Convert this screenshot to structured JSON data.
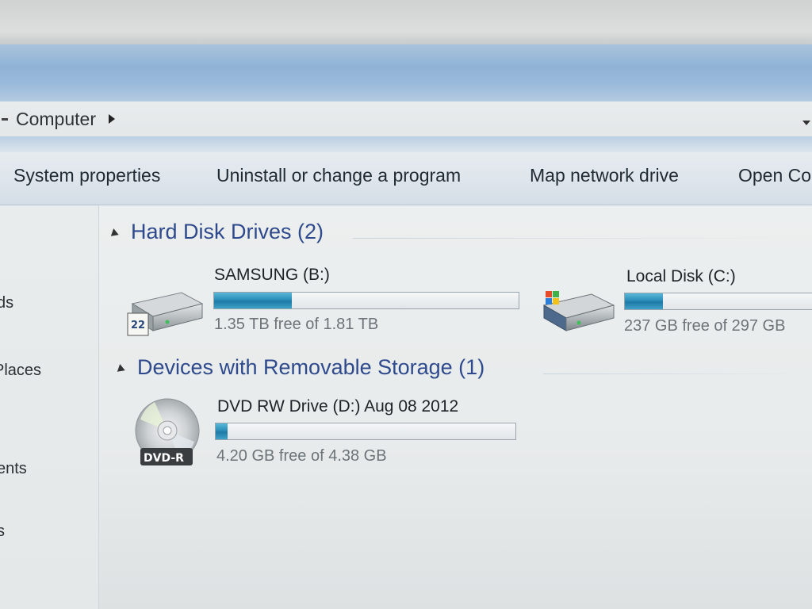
{
  "address": {
    "path": [
      "Computer"
    ]
  },
  "toolbar": {
    "system_properties": "System properties",
    "uninstall": "Uninstall or change a program",
    "map_network": "Map network drive",
    "open_control": "Open Co"
  },
  "nav": {
    "items": [
      {
        "label": "ds"
      },
      {
        "label": "Places"
      },
      {
        "label": "ents"
      },
      {
        "label": "s"
      }
    ]
  },
  "groups": {
    "hard_disks": {
      "title": "Hard Disk Drives (2)",
      "drives": [
        {
          "name": "SAMSUNG (B:)",
          "free_text": "1.35 TB free of 1.81 TB",
          "used_fraction": 0.254,
          "icon": "external-hard-drive-icon",
          "badge": "22"
        },
        {
          "name": "Local Disk (C:)",
          "free_text": "237 GB free of 297 GB",
          "used_fraction": 0.2,
          "icon": "windows-system-drive-icon"
        }
      ]
    },
    "removable": {
      "title": "Devices with Removable Storage (1)",
      "drives": [
        {
          "name": "DVD RW Drive (D:) Aug 08 2012",
          "free_text": "4.20 GB free of 4.38 GB",
          "used_fraction": 0.04,
          "icon": "dvd-disc-icon",
          "badge": "DVD-R"
        }
      ]
    }
  },
  "colors": {
    "titlebar": "#8fb3d6",
    "group_header": "#2e4a8c",
    "bar_fill": "#2b8db8"
  }
}
